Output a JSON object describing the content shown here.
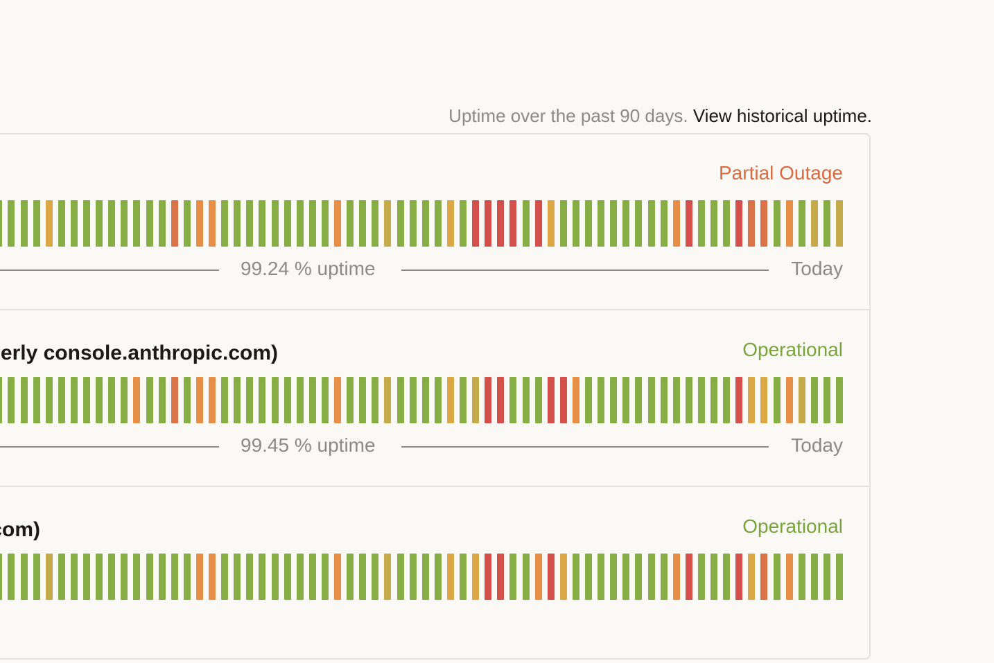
{
  "header": {
    "note": "Uptime over the past 90 days.",
    "link_label": "View historical uptime."
  },
  "status_colors": {
    "g": "#86ae44",
    "o": "#dba845",
    "y": "#c4aa4a",
    "or": "#e88f47",
    "dor": "#dc7348",
    "r": "#d4504a"
  },
  "components": [
    {
      "name": "",
      "status": "Partial Outage",
      "status_color": "#dc6a40",
      "uptime": "99.24 % uptime",
      "today": "Today",
      "days": [
        "g",
        "g",
        "g",
        "g",
        "g",
        "o",
        "g",
        "g",
        "g",
        "g",
        "g",
        "g",
        "g",
        "g",
        "g",
        "dor",
        "g",
        "or",
        "or",
        "g",
        "g",
        "g",
        "g",
        "g",
        "g",
        "g",
        "g",
        "g",
        "or",
        "g",
        "g",
        "g",
        "y",
        "g",
        "g",
        "g",
        "g",
        "o",
        "g",
        "r",
        "r",
        "r",
        "r",
        "g",
        "r",
        "o",
        "g",
        "g",
        "g",
        "g",
        "g",
        "g",
        "g",
        "g",
        "g",
        "or",
        "r",
        "g",
        "g",
        "g",
        "r",
        "dor",
        "dor",
        "g",
        "or",
        "g",
        "y",
        "g",
        "y"
      ]
    },
    {
      "name": "erly console.anthropic.com)",
      "status": "Operational",
      "status_color": "#7aa33c",
      "uptime": "99.45 % uptime",
      "today": "Today",
      "days": [
        "g",
        "g",
        "g",
        "g",
        "g",
        "g",
        "g",
        "g",
        "g",
        "g",
        "g",
        "g",
        "or",
        "g",
        "g",
        "dor",
        "g",
        "or",
        "or",
        "g",
        "g",
        "g",
        "g",
        "g",
        "g",
        "g",
        "g",
        "g",
        "or",
        "g",
        "g",
        "g",
        "y",
        "g",
        "g",
        "g",
        "g",
        "o",
        "g",
        "y",
        "r",
        "r",
        "g",
        "g",
        "g",
        "r",
        "r",
        "or",
        "g",
        "g",
        "g",
        "g",
        "g",
        "g",
        "g",
        "g",
        "g",
        "g",
        "g",
        "g",
        "r",
        "o",
        "o",
        "g",
        "or",
        "y",
        "g",
        "g",
        "g"
      ]
    },
    {
      "name": ".com)",
      "status": "Operational",
      "status_color": "#7aa33c",
      "days": [
        "g",
        "g",
        "g",
        "g",
        "g",
        "y",
        "g",
        "g",
        "g",
        "g",
        "g",
        "g",
        "g",
        "g",
        "g",
        "g",
        "g",
        "or",
        "or",
        "g",
        "g",
        "g",
        "g",
        "g",
        "g",
        "g",
        "g",
        "g",
        "or",
        "g",
        "g",
        "g",
        "y",
        "g",
        "g",
        "g",
        "g",
        "o",
        "g",
        "o",
        "r",
        "r",
        "g",
        "g",
        "or",
        "r",
        "o",
        "g",
        "g",
        "g",
        "g",
        "g",
        "g",
        "g",
        "g",
        "or",
        "r",
        "g",
        "g",
        "g",
        "r",
        "o",
        "dor",
        "g",
        "or",
        "g",
        "g",
        "g",
        "g"
      ]
    }
  ]
}
